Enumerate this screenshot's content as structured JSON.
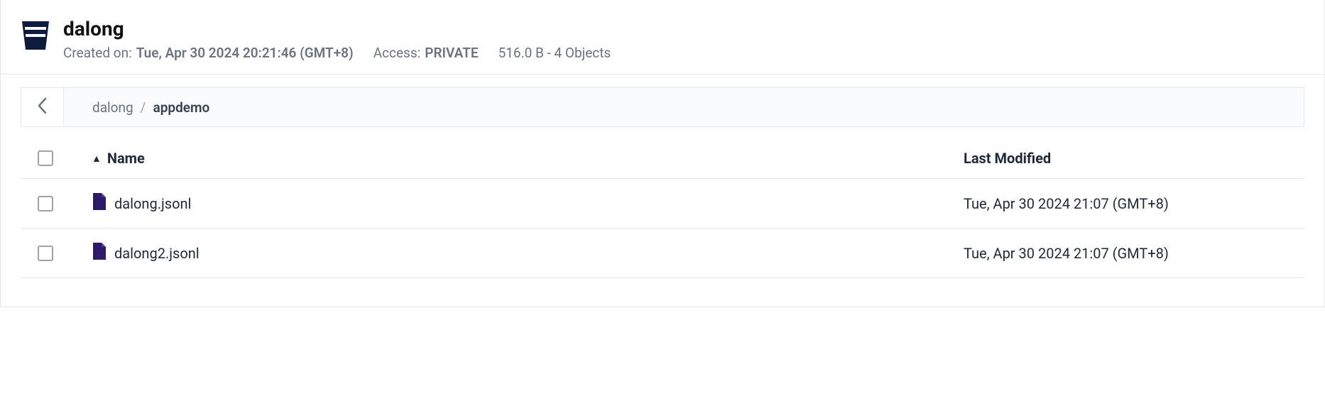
{
  "header": {
    "title": "dalong",
    "created_label": "Created on:",
    "created_value": "Tue, Apr 30 2024 20:21:46 (GMT+8)",
    "access_label": "Access:",
    "access_value": "PRIVATE",
    "stats": "516.0 B - 4 Objects"
  },
  "breadcrumb": {
    "root": "dalong",
    "separator": "/",
    "current": "appdemo"
  },
  "table": {
    "columns": {
      "name": "Name",
      "modified": "Last Modified"
    }
  },
  "files": [
    {
      "name": "dalong.jsonl",
      "modified": "Tue, Apr 30 2024 21:07 (GMT+8)"
    },
    {
      "name": "dalong2.jsonl",
      "modified": "Tue, Apr 30 2024 21:07 (GMT+8)"
    }
  ]
}
